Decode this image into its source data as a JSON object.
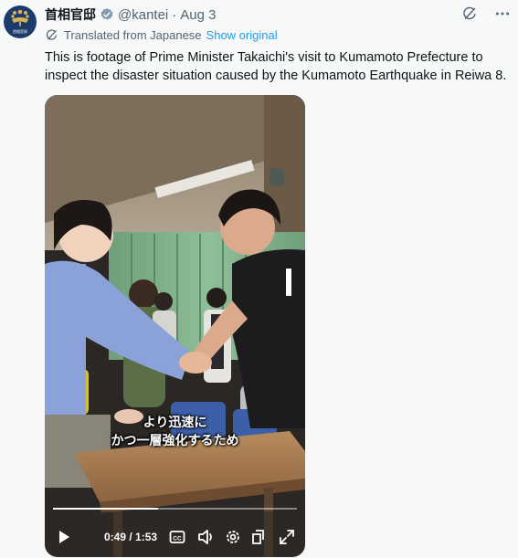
{
  "tweet": {
    "display_name": "首相官邸",
    "handle": "@kantei",
    "separator": "·",
    "date": "Aug 3",
    "translated_label": "Translated from Japanese",
    "show_original": "Show original",
    "text": "This is footage of Prime Minister Takaichi's visit to Kumamoto Prefecture to inspect the disaster situation caused by the Kumamoto Earthquake in Reiwa 8."
  },
  "avatar": {
    "caption": "首相官邸"
  },
  "video": {
    "subtitle_line1": "より迅速に",
    "subtitle_line2": "かつ一層強化するため",
    "time": "0:49 / 1:53",
    "progress": 0.43
  },
  "icons": {
    "verified": "verified-badge-icon",
    "grok": "grok-icon",
    "more": "more-icon",
    "translate": "translate-icon",
    "play": "play-icon",
    "captions": "captions-icon",
    "volume": "volume-icon",
    "settings": "settings-icon",
    "download": "download-icon",
    "fullscreen": "fullscreen-icon"
  },
  "colors": {
    "link": "#1d9bf0",
    "muted": "#536471",
    "text": "#0f1419"
  }
}
